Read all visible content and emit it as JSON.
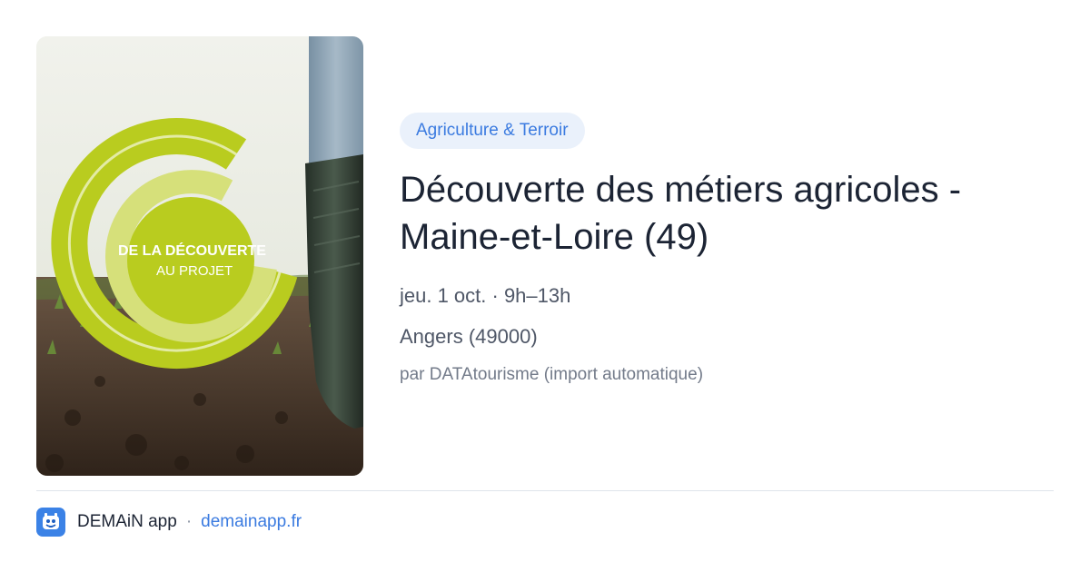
{
  "image": {
    "logo_line1": "DE LA DÉCOUVERTE",
    "logo_line2": "AU PROJET",
    "colors": {
      "ring_outer": "#b9cc1f",
      "ring_inner": "#d6e07a",
      "soil": "#3e2f24",
      "sky": "#eef0ea",
      "boot": "#2f3a31",
      "jeans": "#8da3b4"
    }
  },
  "event": {
    "category": "Agriculture & Terroir",
    "title": "Découverte des métiers agricoles - Maine-et-Loire (49)",
    "date": "jeu. 1 oct. · 9h–13h",
    "location": "Angers (49000)",
    "source": "par DATAtourisme (import automatique)"
  },
  "footer": {
    "app_name": "DEMAiN app",
    "separator": "·",
    "domain": "demainapp.fr",
    "icon": "app-logo-icon"
  },
  "colors": {
    "accent": "#3b7be0",
    "pill_bg": "#eaf1fb",
    "title": "#1c2434",
    "meta": "#4f5767",
    "muted": "#737b8a",
    "divider": "#dfe4ea"
  }
}
